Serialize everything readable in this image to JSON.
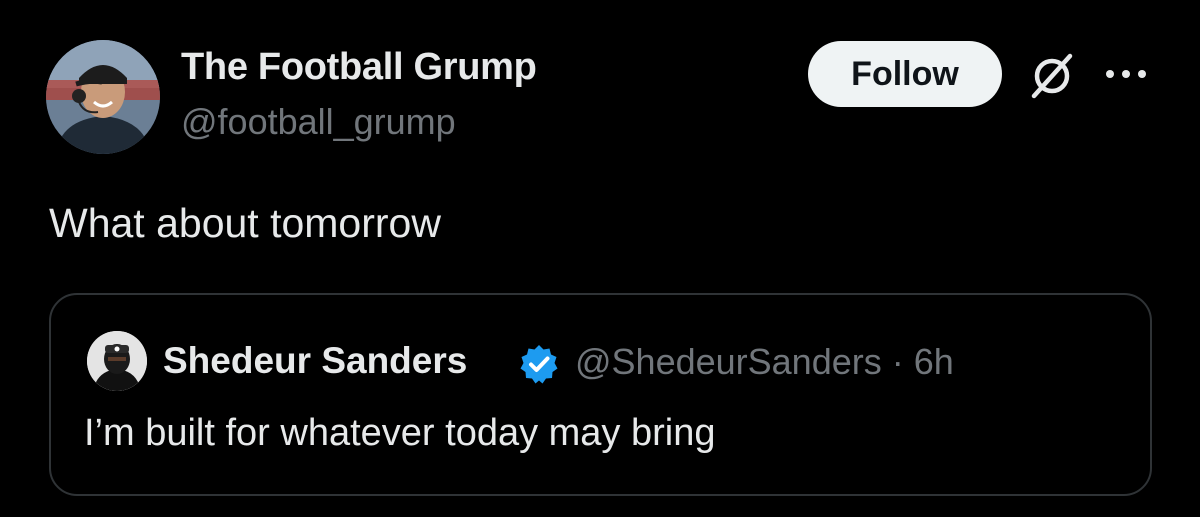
{
  "author": {
    "display_name": "The Football Grump",
    "handle": "@football_grump",
    "avatar_icon": "avatar-photo"
  },
  "actions": {
    "follow_label": "Follow",
    "grok_icon": "grok-icon",
    "more_icon": "more-icon"
  },
  "tweet": {
    "text": "What about tomorrow"
  },
  "quote": {
    "display_name": "Shedeur Sanders",
    "verified": true,
    "handle_time": "@ShedeurSanders · 6h",
    "text": "I’m built for whatever today may bring"
  },
  "colors": {
    "background": "#000000",
    "primary_text": "#e7e9ea",
    "secondary_text": "#71767b",
    "verified_blue": "#1d9bf0",
    "follow_bg": "#eff3f4",
    "border": "#2f3336"
  }
}
